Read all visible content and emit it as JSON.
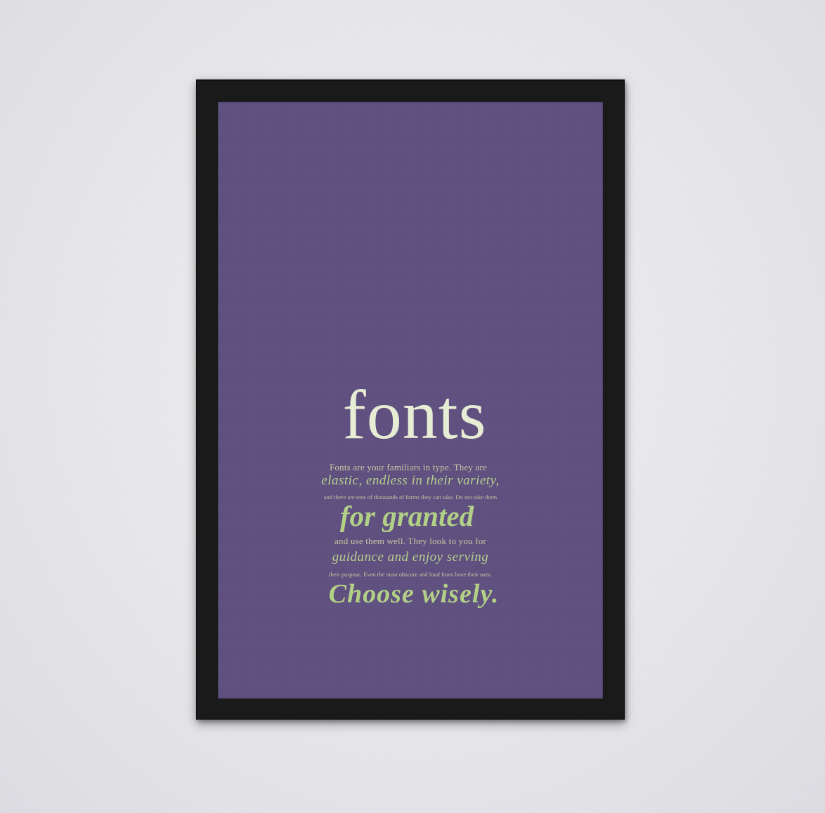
{
  "poster": {
    "background_color": "#5f5080",
    "frame_color": "#1a1a1a",
    "title": "fonts",
    "lines": [
      "Fonts are your familiars in type. They are",
      "elastic, endless in their variety,",
      "and there are tens of thousands of forms they can take. Do not take them",
      "for granted",
      "and use them well. They look to you for",
      "guidance and enjoy serving",
      "their purpose. Even the most obscure and loud fonts have their uses.",
      "Choose wisely."
    ],
    "colors": {
      "title": "#e8eed5",
      "body": "#c7c8a0",
      "accent": "#b3d186"
    }
  }
}
